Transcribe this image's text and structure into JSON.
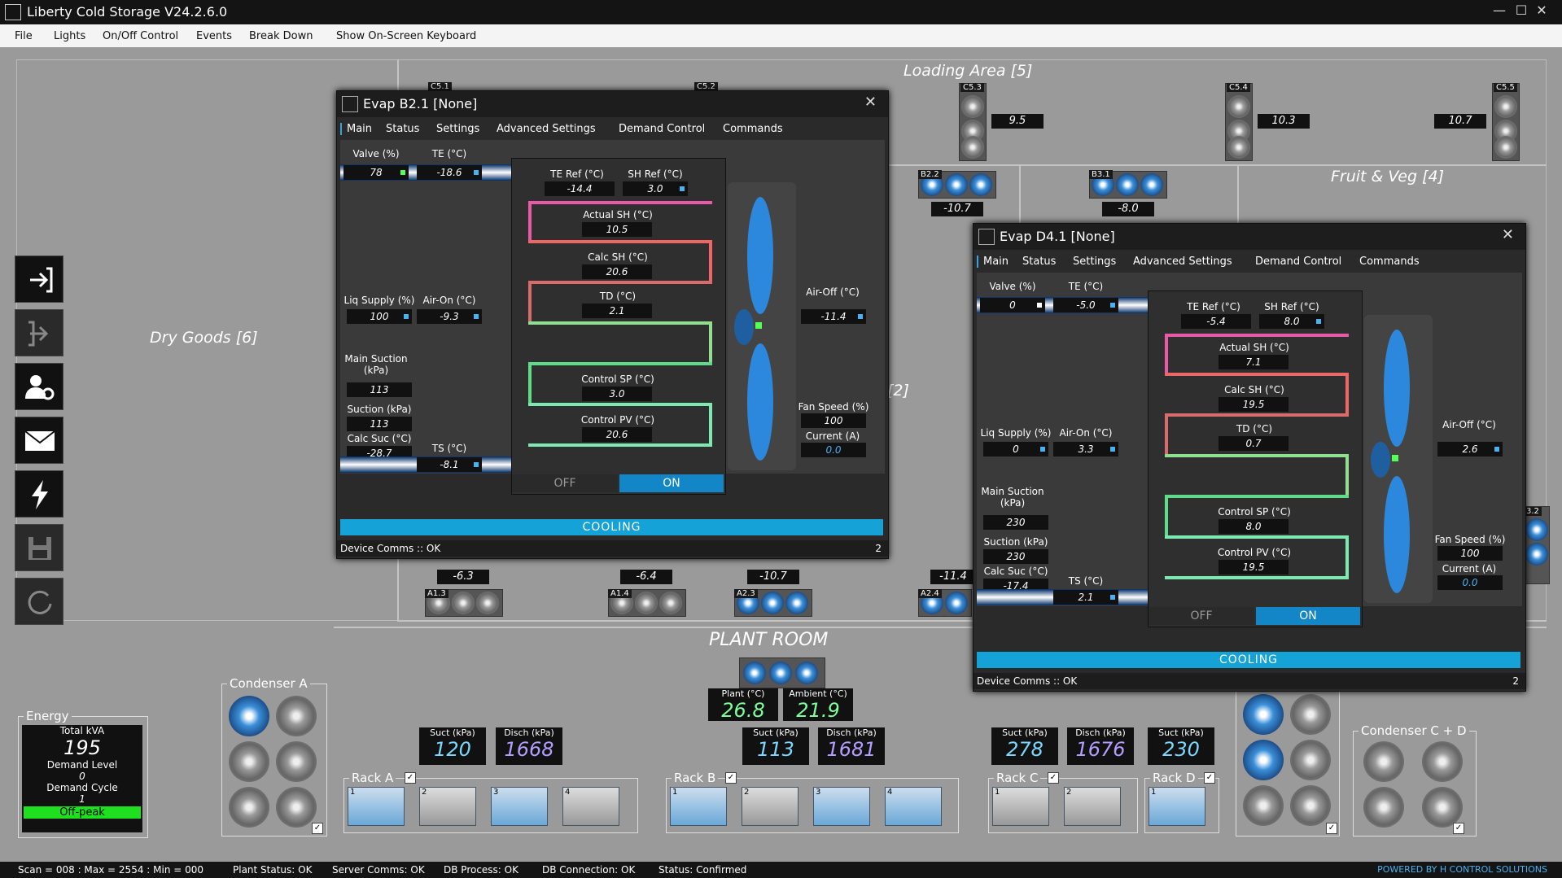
{
  "app": {
    "title": "Liberty Cold Storage V24.2.6.0"
  },
  "menu": [
    "File",
    "Lights",
    "On/Off Control",
    "Events",
    "Break Down",
    "Show On-Screen Keyboard"
  ],
  "zones": {
    "loading": "Loading Area [5]",
    "fruit": "Fruit & Veg [4]",
    "dry": "Dry Goods [6]",
    "partial": "[2]"
  },
  "unit_tags": {
    "c51": "C5.1",
    "c52": "C5.2",
    "c53": "C5.3",
    "c54": "C5.4",
    "c55": "C5.5",
    "b22": "B2.2",
    "b31": "B3.1",
    "a13": "A1.3",
    "a14": "A1.4",
    "a23": "A2.3",
    "a24": "A2.4",
    "e32": "3.2"
  },
  "unit_temps": {
    "c53": "9.5",
    "c54": "10.3",
    "c55": "10.7",
    "b22": "-10.7",
    "b31": "-8.0",
    "a13": "-6.3",
    "a14": "-6.4",
    "a23": "-10.7",
    "a24": "-11.4"
  },
  "evap1": {
    "title": "Evap B2.1 [None]",
    "tabs": [
      "Main",
      "Status",
      "Settings",
      "Advanced Settings",
      "Demand Control",
      "Commands"
    ],
    "valve_label": "Valve (%)",
    "valve": "78",
    "te_label": "TE (°C)",
    "te": "-18.6",
    "te_ref_label": "TE Ref (°C)",
    "te_ref": "-14.4",
    "sh_ref_label": "SH Ref (°C)",
    "sh_ref": "3.0",
    "actual_sh_label": "Actual SH (°C)",
    "actual_sh": "10.5",
    "calc_sh_label": "Calc SH (°C)",
    "calc_sh": "20.6",
    "td_label": "TD (°C)",
    "td": "2.1",
    "control_sp_label": "Control SP (°C)",
    "control_sp": "3.0",
    "control_pv_label": "Control PV (°C)",
    "control_pv": "20.6",
    "liq_label": "Liq Supply (%)",
    "liq": "100",
    "air_on_label": "Air-On (°C)",
    "air_on": "-9.3",
    "air_off_label": "Air-Off (°C)",
    "air_off": "-11.4",
    "main_suction_label": "Main Suction (kPa)",
    "main_suction": "113",
    "suction_label": "Suction (kPa)",
    "suction": "113",
    "calc_suc_label": "Calc Suc (°C)",
    "calc_suc": "-28.7",
    "ts_label": "TS (°C)",
    "ts": "-8.1",
    "fan_speed_label": "Fan Speed (%)",
    "fan_speed": "100",
    "current_label": "Current (A)",
    "current": "0.0",
    "off": "OFF",
    "on": "ON",
    "mode": "COOLING",
    "comms": "Device Comms :: OK",
    "page": "2"
  },
  "evap2": {
    "title": "Evap D4.1 [None]",
    "tabs": [
      "Main",
      "Status",
      "Settings",
      "Advanced Settings",
      "Demand Control",
      "Commands"
    ],
    "valve_label": "Valve (%)",
    "valve": "0",
    "te_label": "TE (°C)",
    "te": "-5.0",
    "te_ref_label": "TE Ref (°C)",
    "te_ref": "-5.4",
    "sh_ref_label": "SH Ref (°C)",
    "sh_ref": "8.0",
    "actual_sh_label": "Actual SH (°C)",
    "actual_sh": "7.1",
    "calc_sh_label": "Calc SH (°C)",
    "calc_sh": "19.5",
    "td_label": "TD (°C)",
    "td": "0.7",
    "control_sp_label": "Control SP (°C)",
    "control_sp": "8.0",
    "control_pv_label": "Control PV (°C)",
    "control_pv": "19.5",
    "liq_label": "Liq Supply (%)",
    "liq": "0",
    "air_on_label": "Air-On (°C)",
    "air_on": "3.3",
    "air_off_label": "Air-Off (°C)",
    "air_off": "2.6",
    "main_suction_label": "Main Suction (kPa)",
    "main_suction": "230",
    "suction_label": "Suction (kPa)",
    "suction": "230",
    "calc_suc_label": "Calc Suc (°C)",
    "calc_suc": "-17.4",
    "ts_label": "TS (°C)",
    "ts": "2.1",
    "fan_speed_label": "Fan Speed (%)",
    "fan_speed": "100",
    "current_label": "Current (A)",
    "current": "0.0",
    "off": "OFF",
    "on": "ON",
    "mode": "COOLING",
    "comms": "Device Comms :: OK",
    "page": "2"
  },
  "plant": {
    "title": "PLANT ROOM",
    "plant_label": "Plant (°C)",
    "plant": "26.8",
    "ambient_label": "Ambient (°C)",
    "ambient": "21.9",
    "suct_label": "Suct (kPa)",
    "disch_label": "Disch (kPa)",
    "a_suct": "120",
    "a_disch": "1668",
    "b_suct": "113",
    "b_disch": "1681",
    "c_suct": "278",
    "c_disch": "1676",
    "d_suct": "230",
    "rack_a": "Rack A",
    "rack_b": "Rack B",
    "rack_c": "Rack C",
    "rack_d": "Rack D",
    "cond_a": "Condenser A",
    "cond_cd": "Condenser C + D"
  },
  "energy": {
    "title": "Energy",
    "kva_label": "Total kVA",
    "kva": "195",
    "dl_label": "Demand Level",
    "dl": "0",
    "dc_label": "Demand Cycle",
    "dc": "1",
    "tariff": "Off-peak"
  },
  "footer": {
    "scan": "Scan = 008 : Max = 2554 : Min = 000",
    "plant": "Plant Status: OK",
    "server": "Server Comms: OK",
    "db_process": "DB Process:  OK",
    "db_conn": "DB Connection:  OK",
    "status": "Status:  Confirmed",
    "powered": "POWERED BY H CONTROL SOLUTIONS"
  }
}
